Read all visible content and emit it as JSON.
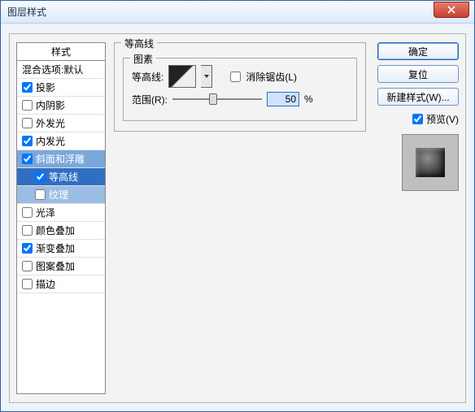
{
  "window": {
    "title": "图层样式"
  },
  "close_icon": "close",
  "styles": {
    "header": "样式",
    "blend_options": "混合选项:默认",
    "items": [
      {
        "label": "投影",
        "checked": true
      },
      {
        "label": "内阴影",
        "checked": false
      },
      {
        "label": "外发光",
        "checked": false
      },
      {
        "label": "内发光",
        "checked": true
      },
      {
        "label": "斜面和浮雕",
        "checked": true
      },
      {
        "label": "等高线",
        "checked": true,
        "sub": true
      },
      {
        "label": "纹理",
        "checked": false,
        "sub": true
      },
      {
        "label": "光泽",
        "checked": false
      },
      {
        "label": "颜色叠加",
        "checked": false
      },
      {
        "label": "渐变叠加",
        "checked": true
      },
      {
        "label": "图案叠加",
        "checked": false
      },
      {
        "label": "描边",
        "checked": false
      }
    ]
  },
  "settings": {
    "group_title": "等高线",
    "sub_group_title": "图素",
    "contour_label": "等高线:",
    "anti_alias": {
      "label": "消除锯齿(L)",
      "checked": false
    },
    "range": {
      "label": "范围(R):",
      "value": "50",
      "unit": "%",
      "percent": 50
    }
  },
  "buttons": {
    "ok": "确定",
    "cancel": "复位",
    "new_style": "新建样式(W)...",
    "preview": {
      "label": "预览(V)",
      "checked": true
    }
  }
}
